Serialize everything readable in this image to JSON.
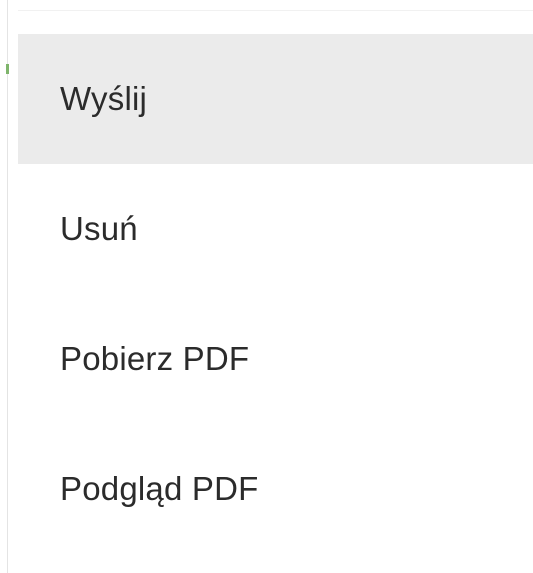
{
  "context_menu": {
    "items": [
      {
        "label": "Wyślij",
        "highlighted": true
      },
      {
        "label": "Usuń",
        "highlighted": false
      },
      {
        "label": "Pobierz PDF",
        "highlighted": false
      },
      {
        "label": "Podgląd PDF",
        "highlighted": false
      }
    ],
    "colors": {
      "highlight_background": "#ebebeb",
      "text": "#2b2b2b",
      "accent_mark": "#7fb56c"
    }
  }
}
